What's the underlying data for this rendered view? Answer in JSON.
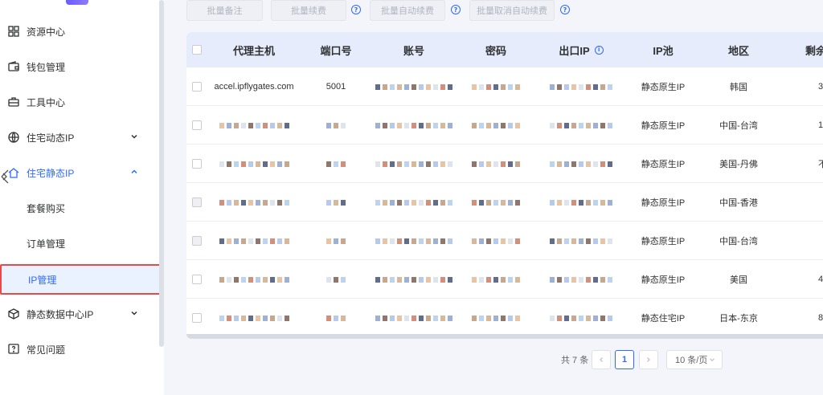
{
  "sidebar": {
    "items": [
      {
        "label": "资源中心",
        "icon": "grid-icon"
      },
      {
        "label": "钱包管理",
        "icon": "wallet-icon"
      },
      {
        "label": "工具中心",
        "icon": "toolbox-icon"
      },
      {
        "label": "住宅动态IP",
        "icon": "globe-icon"
      },
      {
        "label": "住宅静态IP",
        "icon": "home-icon"
      },
      {
        "label": "静态数据中心IP",
        "icon": "cube-icon"
      },
      {
        "label": "常见问题",
        "icon": "question-icon"
      }
    ],
    "sub_items": [
      {
        "label": "套餐购买"
      },
      {
        "label": "订单管理"
      },
      {
        "label": "IP管理"
      }
    ]
  },
  "toolbar": {
    "batch_note": "批量备注",
    "batch_renew": "批量续费",
    "batch_auto_renew": "批量自动续费",
    "batch_cancel_auto_renew": "批量取消自动续费"
  },
  "table": {
    "headers": [
      "代理主机",
      "端口号",
      "账号",
      "密码",
      "出口IP",
      "IP池",
      "地区",
      "剩余"
    ],
    "rows": [
      {
        "host": "accel.ipflygates.com",
        "port": "5001",
        "pool": "静态原生IP",
        "region": "韩国",
        "remain": "3"
      },
      {
        "host": "",
        "port": "",
        "pool": "静态原生IP",
        "region": "中国-台湾",
        "remain": "1"
      },
      {
        "host": "",
        "port": "",
        "pool": "静态原生IP",
        "region": "美国-丹佛",
        "remain": "不足"
      },
      {
        "host": "",
        "port": "",
        "pool": "静态原生IP",
        "region": "中国-香港",
        "remain": ""
      },
      {
        "host": "",
        "port": "",
        "pool": "静态原生IP",
        "region": "中国-台湾",
        "remain": ""
      },
      {
        "host": "",
        "port": "",
        "pool": "静态原生IP",
        "region": "美国",
        "remain": "4"
      },
      {
        "host": "",
        "port": "",
        "pool": "静态住宅IP",
        "region": "日本-东京",
        "remain": "8"
      }
    ]
  },
  "pagination": {
    "total": "共 7 条",
    "current_page": "1",
    "page_size": "10 条/页"
  },
  "colors": {
    "accent": "#2f6bff",
    "highlight_border": "#e84a4a",
    "header_bg": "#e6ecfb"
  }
}
